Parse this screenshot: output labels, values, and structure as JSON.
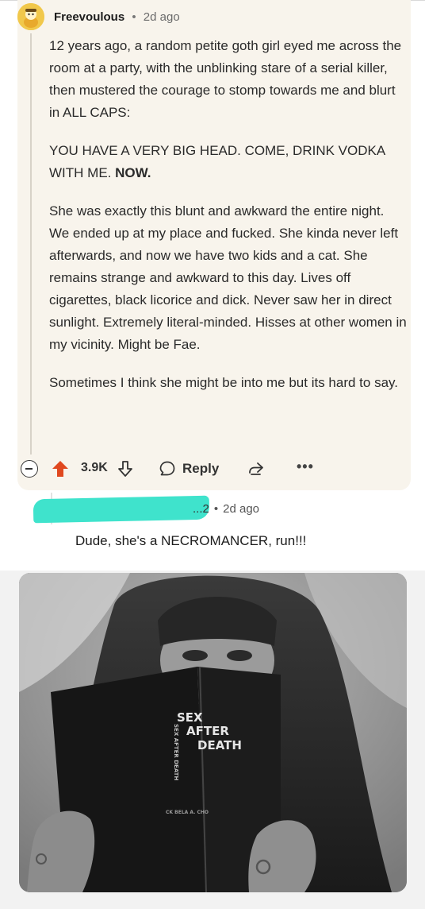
{
  "comment": {
    "username": "Freevoulous",
    "separator": "•",
    "age": "2d ago",
    "paragraphs": [
      "12 years ago, a random petite goth girl eyed me across the room at a party, with the unblinking stare of a serial killer, then mustered the courage to stomp towards me and blurt in ALL CAPS:",
      "She was exactly this blunt and awkward the entire night. We ended up at my place and fucked. She kinda never left afterwards, and now we have two kids and a cat. She remains strange and awkward to this day. Lives off cigarettes, black licorice and dick. Never saw her in direct sunlight. Extremely literal-minded. Hisses at other women in my vicinity. Might be Fae.",
      "Sometimes I think she might be into me but its hard to say."
    ],
    "caps_line": "YOU HAVE A VERY BIG HEAD. COME, DRINK VODKA WITH ME.",
    "caps_bold": "NOW.",
    "score": "3.9K",
    "reply_label": "Reply",
    "more_label": "•••"
  },
  "reply": {
    "username_fragment": "...2",
    "separator": "•",
    "age": "2d ago",
    "text": "Dude, she's a NECROMANCER, run!!!"
  },
  "image": {
    "book_title_lines": [
      "SEX",
      "AFTER",
      "DEATH"
    ],
    "book_spine": "SEX AFTER DEATH",
    "book_author": "CK BELA A. CHO"
  },
  "colors": {
    "card_bg": "#f8f4ec",
    "upvote": "#e0481f",
    "redaction": "#3fe3cc",
    "avatar": "#f1c84b"
  },
  "icons": [
    "collapse-icon",
    "upvote-icon",
    "downvote-icon",
    "comment-icon",
    "share-icon",
    "more-icon"
  ]
}
